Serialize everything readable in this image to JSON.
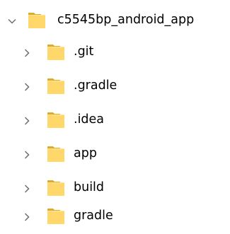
{
  "colors": {
    "folder_back": "#e0a92a",
    "folder_front": "#ffd76a",
    "chevron": "#6e6e6e",
    "text": "#000000"
  },
  "tree": {
    "root": {
      "label": "c5545bp_android_app",
      "expanded": true,
      "icon": "folder-icon",
      "chevron": "chevron-down-icon"
    },
    "children": [
      {
        "label": ".git",
        "expanded": false,
        "icon": "folder-icon",
        "chevron": "chevron-right-icon"
      },
      {
        "label": ".gradle",
        "expanded": false,
        "icon": "folder-icon",
        "chevron": "chevron-right-icon"
      },
      {
        "label": ".idea",
        "expanded": false,
        "icon": "folder-icon",
        "chevron": "chevron-right-icon"
      },
      {
        "label": "app",
        "expanded": false,
        "icon": "folder-icon",
        "chevron": "chevron-right-icon"
      },
      {
        "label": "build",
        "expanded": false,
        "icon": "folder-icon",
        "chevron": "chevron-right-icon"
      },
      {
        "label": "gradle",
        "expanded": false,
        "icon": "folder-icon",
        "chevron": "chevron-right-icon"
      }
    ]
  }
}
